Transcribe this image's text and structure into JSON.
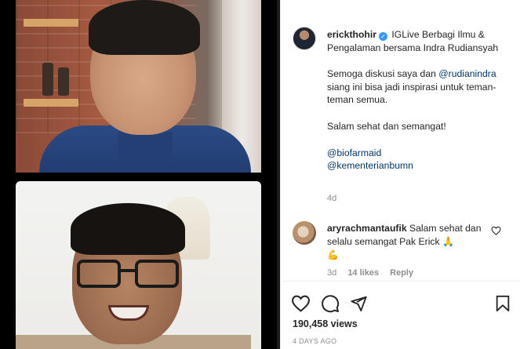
{
  "post": {
    "author": "erickthohir",
    "verified_badge": "✓",
    "caption_lines": {
      "line1": "IGLive Berbagi Ilmu & Pengalaman bersama Indra Rudiansyah",
      "line2_prefix": "Semoga diskusi saya dan",
      "line2_mention": "@rudianindra",
      "line2_suffix": "siang ini bisa jadi inspirasi untuk teman-teman semua.",
      "line3": "Salam sehat dan semangat!",
      "mention1": "@biofarmaid",
      "mention2": "@kementerianbumn"
    },
    "caption_time": "4d"
  },
  "comment": {
    "username": "aryrachmantaufik",
    "text": "Salam sehat dan selalu semangat Pak Erick",
    "emoji1": "🙏",
    "emoji2": "💪",
    "time": "3d",
    "likes": "14 likes",
    "reply": "Reply"
  },
  "stats": {
    "views": "190,458 views",
    "date": "4 DAYS AGO"
  },
  "icons": {
    "like": "heart-icon",
    "comment": "comment-icon",
    "share": "share-icon",
    "save": "bookmark-icon",
    "comment_like": "heart-icon"
  },
  "colors": {
    "mention": "#00376b",
    "meta": "#8e8e8e",
    "verified": "#3897f0"
  }
}
